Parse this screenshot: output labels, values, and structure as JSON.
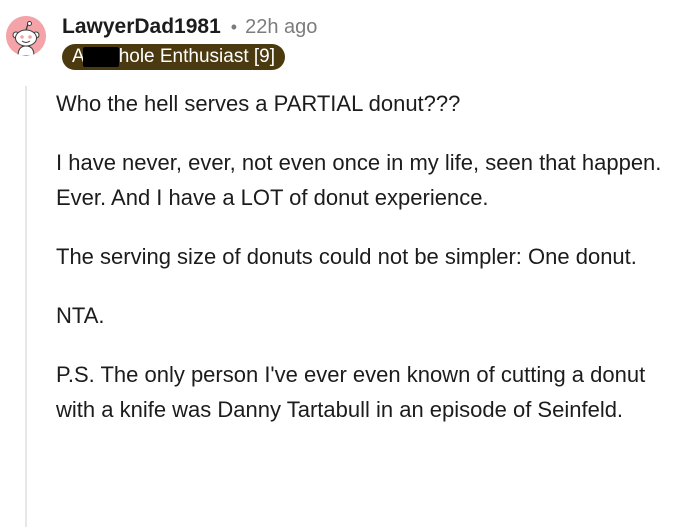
{
  "comment": {
    "username": "LawyerDad1981",
    "separator": "•",
    "time": "22h ago",
    "flair": {
      "prefix": "A",
      "suffix": "hole Enthusiast [9]",
      "redaction": "black-redaction-bar"
    },
    "avatar_icon": "snoo-avatar-icon",
    "colors": {
      "avatar_bg": "#f4a3a8",
      "flair_bg": "#4b3a10",
      "flair_text": "#ffffff",
      "meta_text": "#7c7c7c",
      "thread_line": "#e5e7e9"
    },
    "paragraphs": [
      "Who the hell serves a PARTIAL donut???",
      "I have never, ever, not even once in my life, seen that happen. Ever. And I have a LOT of donut experience.",
      "The serving size of donuts could not be simpler: One donut.",
      "NTA.",
      "P.S. The only person I've ever even known of cutting a donut with a knife was Danny Tartabull in an episode of Seinfeld."
    ]
  }
}
